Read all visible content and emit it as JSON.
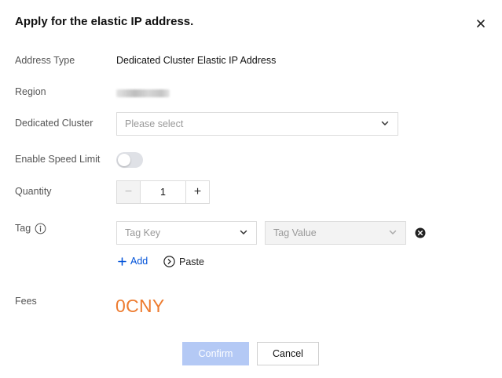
{
  "dialog": {
    "title": "Apply for the elastic IP address.",
    "close_icon": "close-icon"
  },
  "form": {
    "address_type": {
      "label": "Address Type",
      "value": "Dedicated Cluster Elastic IP Address"
    },
    "region": {
      "label": "Region",
      "value_obscured": true
    },
    "dedicated_cluster": {
      "label": "Dedicated Cluster",
      "placeholder": "Please select"
    },
    "speed_limit": {
      "label": "Enable Speed Limit",
      "enabled": false
    },
    "quantity": {
      "label": "Quantity",
      "value": "1",
      "minus": "−",
      "plus": "+"
    },
    "tag": {
      "label": "Tag",
      "key_placeholder": "Tag Key",
      "value_placeholder": "Tag Value",
      "add_label": "Add",
      "paste_label": "Paste"
    },
    "fees": {
      "label": "Fees",
      "value": "0CNY"
    }
  },
  "footer": {
    "confirm_label": "Confirm",
    "cancel_label": "Cancel"
  },
  "colors": {
    "accent": "#0052d9",
    "fees": "#ed7b2f",
    "confirm_disabled": "#b4c9f5"
  }
}
